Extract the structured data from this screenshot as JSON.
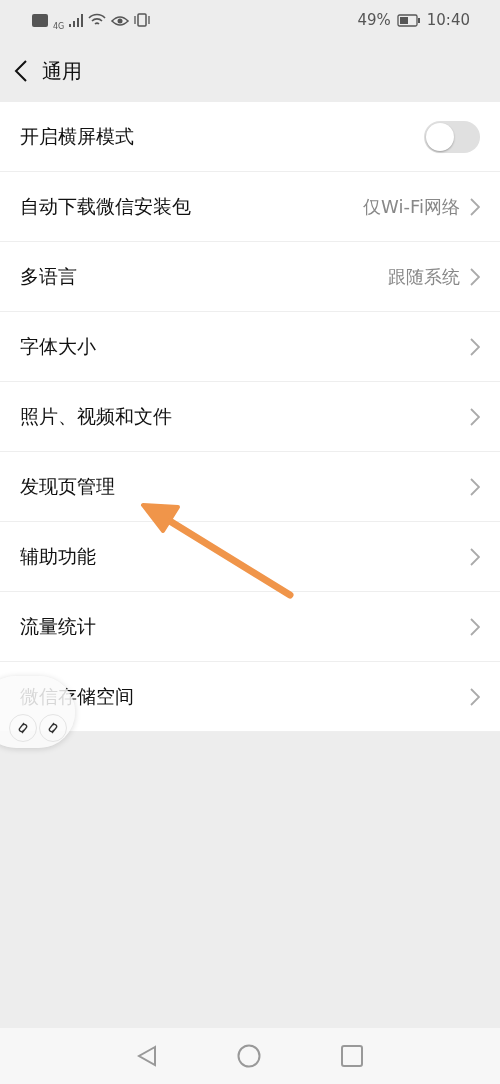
{
  "status_bar": {
    "network": "4G",
    "battery": "49%",
    "time": "10:40"
  },
  "header": {
    "title": "通用"
  },
  "settings": [
    {
      "kind": "toggle",
      "label": "开启横屏模式",
      "on": false
    },
    {
      "kind": "link",
      "label": "自动下载微信安装包",
      "value": "仅Wi-Fi网络"
    },
    {
      "kind": "link",
      "label": "多语言",
      "value": "跟随系统"
    },
    {
      "kind": "link",
      "label": "字体大小"
    },
    {
      "kind": "link",
      "label": "照片、视频和文件"
    },
    {
      "kind": "link",
      "label": "发现页管理"
    },
    {
      "kind": "link",
      "label": "辅助功能"
    },
    {
      "kind": "link",
      "label": "流量统计"
    },
    {
      "kind": "link",
      "label": "微信存储空间"
    }
  ]
}
